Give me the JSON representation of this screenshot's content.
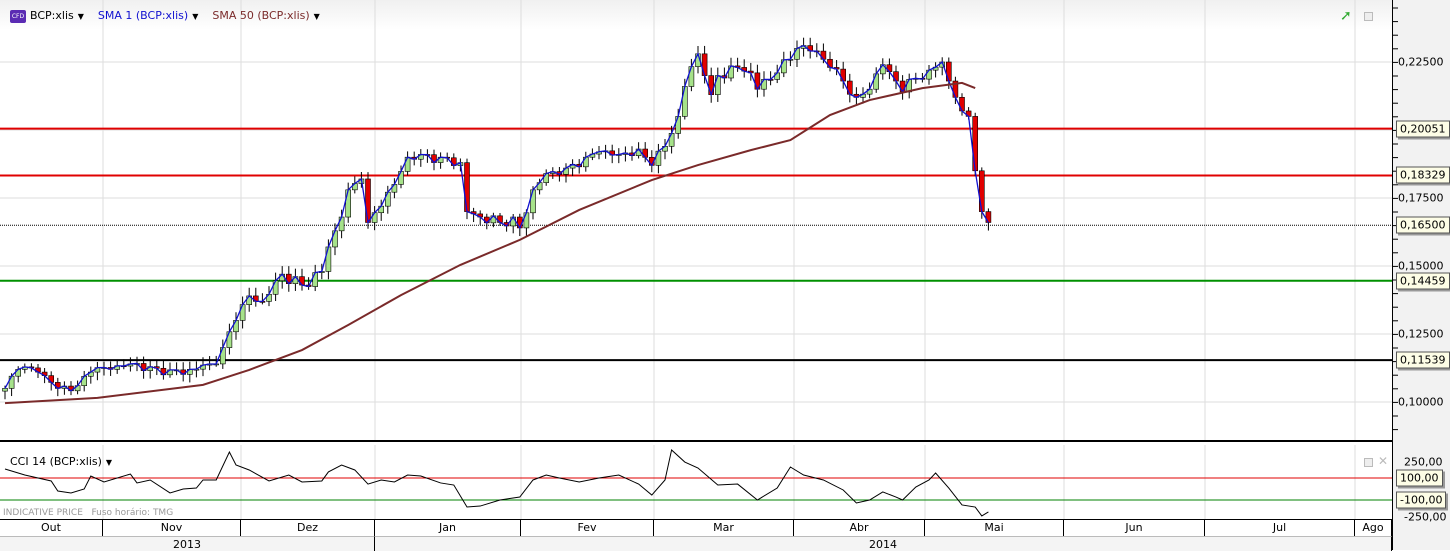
{
  "legend": {
    "symbol": "BCP:xlis",
    "sma1": "SMA 1 (BCP:xlis)",
    "sma50": "SMA 50 (BCP:xlis)",
    "cfd_badge": "CFD"
  },
  "cci_legend": "CCI 14 (BCP:xlis)",
  "footer": {
    "indicative": "INDICATIVE PRICE",
    "timezone": "Fuso horário: TMG"
  },
  "colors": {
    "up": "#a6e28a",
    "down": "#e00000",
    "sma1": "#1010d0",
    "sma50": "#7a2a2a",
    "resistance": "#e00000",
    "support": "#009000"
  },
  "price_axis": [
    "0,22500",
    "0,17500",
    "0,15000",
    "0,12500",
    "0,10000"
  ],
  "cci_axis": [
    "250,00",
    "-250,00"
  ],
  "cci_levels": [
    {
      "label": "100,00",
      "value": 100,
      "color": "#e00000"
    },
    {
      "label": "-100,00",
      "value": -100,
      "color": "#008000"
    }
  ],
  "hlines": [
    {
      "label": "0,20051",
      "value": 0.20051,
      "color": "#e00000",
      "style": "solid"
    },
    {
      "label": "0,18329",
      "value": 0.18329,
      "color": "#e00000",
      "style": "solid"
    },
    {
      "label": "0,16500",
      "value": 0.165,
      "color": "#000000",
      "style": "dotted"
    },
    {
      "label": "0,14459",
      "value": 0.14459,
      "color": "#009000",
      "style": "solid"
    },
    {
      "label": "0,11539",
      "value": 0.11539,
      "color": "#000000",
      "style": "solid"
    }
  ],
  "months": [
    "Out",
    "Nov",
    "Dez",
    "Jan",
    "Fev",
    "Mar",
    "Abr",
    "Mai",
    "Jun",
    "Jul",
    "Ago"
  ],
  "years": [
    "2013",
    "2014"
  ],
  "chart_data": {
    "type": "candlestick",
    "ylim": [
      0.085,
      0.245
    ],
    "close_anchors": {
      "day": [
        0,
        2,
        5,
        8,
        11,
        13,
        16,
        19,
        22,
        24,
        28,
        32,
        33,
        35,
        37,
        39,
        42,
        45,
        48,
        49,
        51,
        52,
        54,
        55,
        57,
        59,
        61,
        63,
        66,
        69,
        70,
        72,
        75,
        77,
        78,
        80,
        82,
        85,
        88,
        90,
        93,
        96,
        98,
        100,
        102,
        103,
        105,
        106,
        107,
        108,
        111,
        113,
        114,
        117,
        119,
        120,
        123,
        125,
        127,
        129,
        131,
        133,
        135,
        136,
        138,
        140,
        142,
        143,
        145,
        146,
        147,
        148,
        149
      ],
      "close": [
        0.105,
        0.112,
        0.111,
        0.105,
        0.106,
        0.111,
        0.112,
        0.114,
        0.113,
        0.11,
        0.112,
        0.114,
        0.12,
        0.13,
        0.139,
        0.137,
        0.147,
        0.143,
        0.148,
        0.157,
        0.168,
        0.178,
        0.182,
        0.166,
        0.172,
        0.18,
        0.19,
        0.191,
        0.19,
        0.188,
        0.17,
        0.168,
        0.166,
        0.168,
        0.164,
        0.178,
        0.184,
        0.186,
        0.19,
        0.192,
        0.191,
        0.193,
        0.187,
        0.194,
        0.205,
        0.216,
        0.228,
        0.22,
        0.213,
        0.22,
        0.223,
        0.221,
        0.215,
        0.221,
        0.226,
        0.23,
        0.229,
        0.223,
        0.218,
        0.212,
        0.215,
        0.224,
        0.218,
        0.214,
        0.219,
        0.222,
        0.225,
        0.218,
        0.207,
        0.205,
        0.185,
        0.17,
        0.166
      ]
    },
    "sma50": {
      "day": [
        0,
        14,
        30,
        37,
        45,
        52,
        60,
        69,
        78,
        87,
        98,
        105,
        113,
        119,
        125,
        131,
        139,
        145,
        147
      ],
      "value": [
        0.0996,
        0.1015,
        0.1063,
        0.1118,
        0.1191,
        0.1283,
        0.1393,
        0.1504,
        0.1596,
        0.1706,
        0.1816,
        0.1871,
        0.1926,
        0.1963,
        0.2055,
        0.211,
        0.2154,
        0.2173,
        0.2154
      ]
    },
    "cci14": {
      "day": [
        0,
        3,
        7,
        8,
        10,
        12,
        13,
        15,
        19,
        20,
        22,
        25,
        27,
        29,
        30,
        32,
        34,
        35,
        37,
        40,
        43,
        45,
        48,
        49,
        51,
        53,
        55,
        57,
        59,
        61,
        63,
        66,
        68,
        70,
        72,
        75,
        78,
        80,
        82,
        84,
        87,
        90,
        93,
        96,
        98,
        100,
        101,
        103,
        105,
        108,
        111,
        114,
        117,
        119,
        121,
        124,
        127,
        129,
        131,
        133,
        135,
        136,
        138,
        140,
        141,
        143,
        145,
        147,
        148,
        149
      ],
      "value": [
        182,
        127,
        73,
        -18,
        -36,
        0,
        118,
        64,
        136,
        55,
        82,
        -36,
        0,
        9,
        82,
        82,
        336,
        218,
        173,
        73,
        127,
        64,
        73,
        155,
        218,
        173,
        45,
        82,
        64,
        127,
        118,
        55,
        36,
        -164,
        -155,
        -100,
        -73,
        82,
        127,
        100,
        64,
        100,
        127,
        45,
        -55,
        82,
        355,
        245,
        191,
        36,
        45,
        -100,
        9,
        200,
        127,
        82,
        -9,
        -127,
        -100,
        -27,
        -73,
        -100,
        18,
        82,
        145,
        9,
        -145,
        -164,
        -245,
        -209
      ]
    }
  }
}
